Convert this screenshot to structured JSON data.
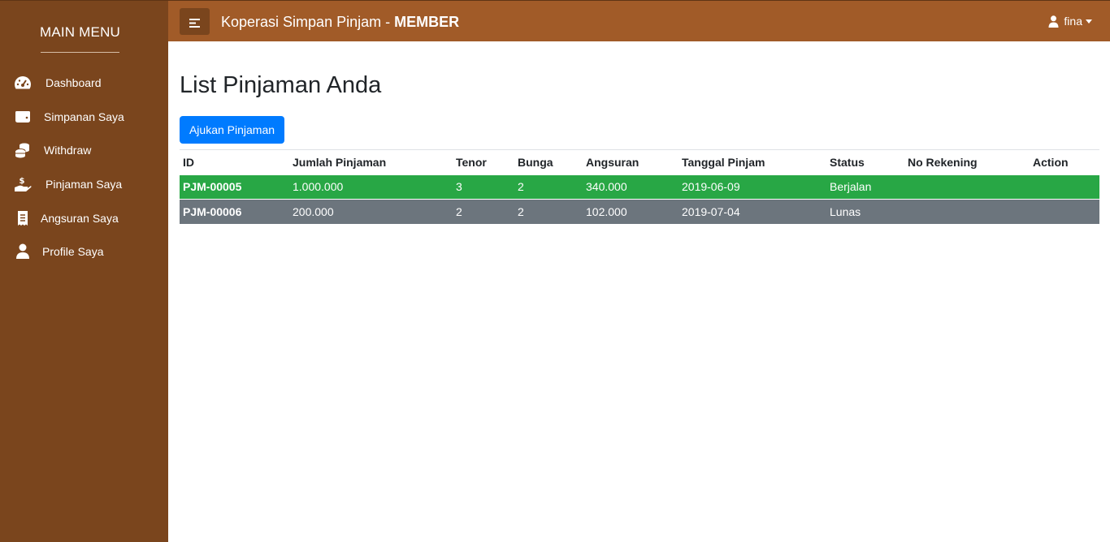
{
  "sidebar": {
    "title": "MAIN MENU",
    "items": [
      {
        "label": "Dashboard",
        "icon": "tachometer-icon"
      },
      {
        "label": "Simpanan Saya",
        "icon": "wallet-icon"
      },
      {
        "label": "Withdraw",
        "icon": "coins-icon"
      },
      {
        "label": "Pinjaman Saya",
        "icon": "hand-dollar-icon"
      },
      {
        "label": "Angsuran Saya",
        "icon": "receipt-icon"
      },
      {
        "label": "Profile Saya",
        "icon": "user-icon"
      }
    ]
  },
  "topbar": {
    "brand_prefix": "Koperasi Simpan Pinjam - ",
    "brand_role": "MEMBER",
    "user": "fina"
  },
  "main": {
    "title": "List Pinjaman Anda",
    "add_button": "Ajukan Pinjaman",
    "table": {
      "headers": [
        "ID",
        "Jumlah Pinjaman",
        "Tenor",
        "Bunga",
        "Angsuran",
        "Tanggal Pinjam",
        "Status",
        "No Rekening",
        "Action"
      ],
      "rows": [
        {
          "id": "PJM-00005",
          "jumlah": "1.000.000",
          "tenor": "3",
          "bunga": "2",
          "angsuran": "340.000",
          "tanggal": "2019-06-09",
          "status": "Berjalan",
          "rekening": "",
          "action": ""
        },
        {
          "id": "PJM-00006",
          "jumlah": "200.000",
          "tenor": "2",
          "bunga": "2",
          "angsuran": "102.000",
          "tanggal": "2019-07-04",
          "status": "Lunas",
          "rekening": "",
          "action": ""
        }
      ]
    }
  },
  "colors": {
    "sidebar_bg": "#7a451d",
    "topbar_bg": "#a15b28",
    "primary": "#007bff",
    "row_berjalan": "#28a745",
    "row_lunas": "#6c757d"
  }
}
